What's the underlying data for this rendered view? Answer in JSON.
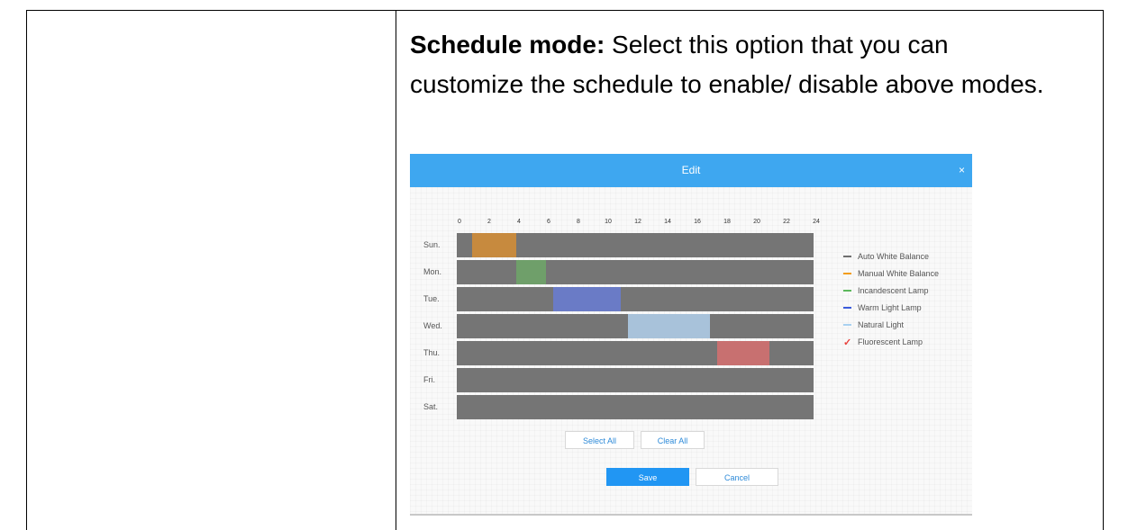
{
  "description": {
    "term": "Schedule mode:",
    "text": " Select this option that you can customize the schedule to enable/ disable above modes."
  },
  "dialog": {
    "title": "Edit",
    "close_glyph": "×",
    "hours": [
      "0",
      "2",
      "4",
      "6",
      "8",
      "10",
      "12",
      "14",
      "16",
      "18",
      "20",
      "22",
      "24"
    ],
    "days": [
      "Sun.",
      "Mon.",
      "Tue.",
      "Wed.",
      "Thu.",
      "Fri.",
      "Sat."
    ],
    "legend": [
      {
        "label": "Auto White Balance",
        "color": "#6f6f6f",
        "icon": "line"
      },
      {
        "label": "Manual White Balance",
        "color": "#f39c12",
        "icon": "line"
      },
      {
        "label": "Incandescent Lamp",
        "color": "#5cb85c",
        "icon": "line"
      },
      {
        "label": "Warm Light Lamp",
        "color": "#3b5bdb",
        "icon": "line"
      },
      {
        "label": "Natural Light",
        "color": "#a8d1f0",
        "icon": "line"
      },
      {
        "label": "Fluorescent Lamp",
        "color": "#e8413c",
        "icon": "checkmark-icon"
      }
    ],
    "schedule": [
      {
        "day": "Sun.",
        "mode": "Manual White Balance",
        "start": 1,
        "end": 4,
        "color": "#c78a3e"
      },
      {
        "day": "Mon.",
        "mode": "Incandescent Lamp",
        "start": 4,
        "end": 6,
        "color": "#6f9f6a"
      },
      {
        "day": "Tue.",
        "mode": "Warm Light Lamp",
        "start": 6.5,
        "end": 11,
        "color": "#6a7bc6"
      },
      {
        "day": "Wed.",
        "mode": "Natural Light",
        "start": 11.5,
        "end": 17,
        "color": "#a8c2da"
      },
      {
        "day": "Thu.",
        "mode": "Fluorescent Lamp",
        "start": 17.5,
        "end": 21,
        "color": "#c87070"
      }
    ],
    "buttons": {
      "select_all": "Select All",
      "clear_all": "Clear All",
      "save": "Save",
      "cancel": "Cancel"
    },
    "colors": {
      "header": "#3ea7f0",
      "row_default": "#757575",
      "primary": "#2196f3"
    }
  }
}
